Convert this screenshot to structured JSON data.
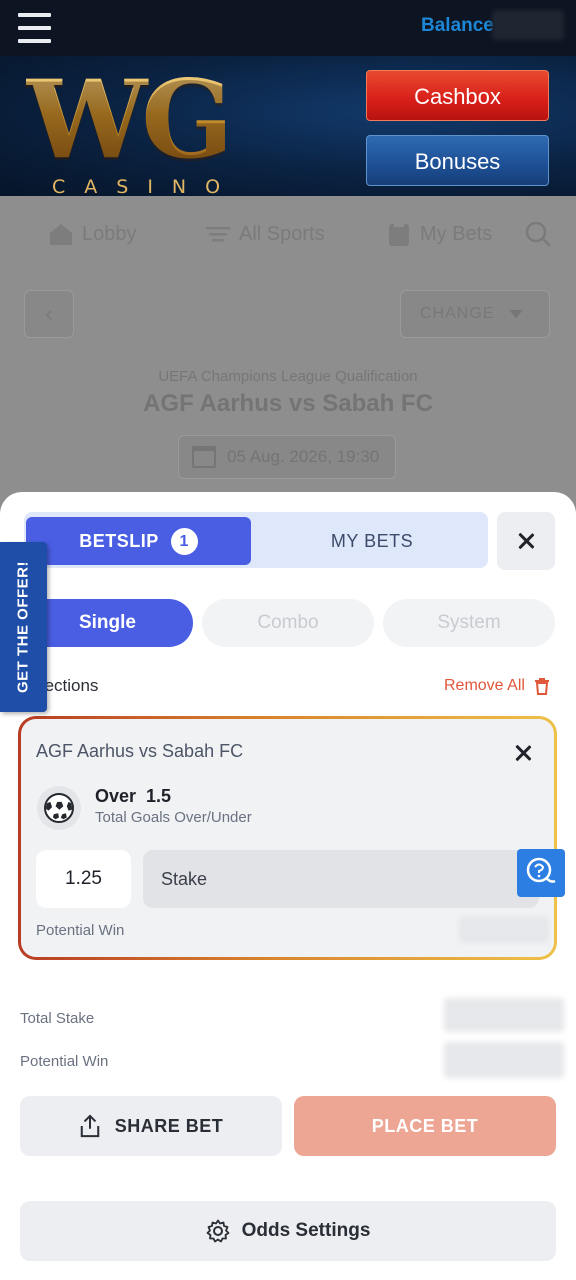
{
  "topbar": {
    "balance_label": "Balance"
  },
  "header": {
    "logo_text": "WG",
    "logo_subtext": "CASINO",
    "cashbox_label": "Cashbox",
    "bonuses_label": "Bonuses"
  },
  "background_page": {
    "nav": [
      {
        "label": "Lobby",
        "icon": "home-icon"
      },
      {
        "label": "All Sports",
        "icon": "list-icon"
      },
      {
        "label": "My Bets",
        "icon": "clipboard-icon"
      }
    ],
    "change_label": "CHANGE",
    "league": "UEFA Champions League Qualification",
    "match_title": "AGF Aarhus vs Sabah FC",
    "match_datetime": "05 Aug. 2026, 19:30"
  },
  "betslip": {
    "tabs": {
      "betslip_label": "BETSLIP",
      "betslip_count": "1",
      "mybets_label": "MY BETS"
    },
    "bet_types": [
      "Single",
      "Combo",
      "System"
    ],
    "selections_label": "Selections",
    "remove_all_label": "Remove All",
    "selection": {
      "match": "AGF Aarhus vs Sabah FC",
      "outcome": "Over  1.5",
      "market": "Total Goals Over/Under",
      "odds": "1.25",
      "stake_placeholder": "Stake",
      "potential_win_label": "Potential Win"
    },
    "offer_label": "GET THE OFFER!",
    "total_stake_label": "Total Stake",
    "potential_win_label": "Potential Win",
    "share_bet_label": "SHARE BET",
    "place_bet_label": "PLACE BET",
    "odds_settings_label": "Odds Settings"
  },
  "colors": {
    "primary": "#4a5ee4",
    "accent_red": "#e0573a",
    "place_bet_disabled": "#eda594",
    "header_bg": "#0a2140",
    "balance_blue": "#1d86d6"
  }
}
